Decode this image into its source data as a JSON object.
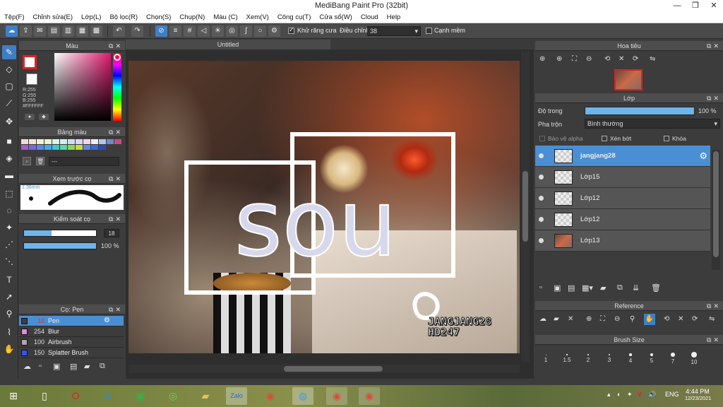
{
  "app": {
    "title": "MediBang Paint Pro (32bit)"
  },
  "menu": [
    "Tệp(F)",
    "Chỉnh sửa(E)",
    "Lớp(L)",
    "Bộ lọc(R)",
    "Chọn(S)",
    "Chụp(N)",
    "Màu (C)",
    "Xem(V)",
    "Công cụ(T)",
    "Cửa sổ(W)",
    "Cloud",
    "Help"
  ],
  "toolbar": {
    "antialias_label": "Khử răng cưa",
    "adjust_label": "Điều chỉnh",
    "adjust_value": "38",
    "smooth_label": "Cạnh mềm"
  },
  "color_panel": {
    "title": "Màu",
    "r": "R:255",
    "g": "G:255",
    "b": "B:255",
    "hex": "#FFFFFF"
  },
  "palette_panel": {
    "title": "Bảng màu",
    "palette_name": "---"
  },
  "brush_preview": {
    "title": "Xem trước cọ",
    "size": "1.36mm"
  },
  "brush_control": {
    "title": "Kiểm soát cọ",
    "size_value": "18",
    "opacity_value": "100 %",
    "size_fill": 0.38,
    "opacity_fill": 1.0
  },
  "brush_list": {
    "title": "Cọ: Pen",
    "items": [
      {
        "size": "18",
        "name": "Pen",
        "color": "#3d3d3d",
        "selected": true
      },
      {
        "size": "254",
        "name": "Blur",
        "color": "#d890d8",
        "selected": false
      },
      {
        "size": "100",
        "name": "Airbrush",
        "color": "#aaaaaa",
        "selected": false
      },
      {
        "size": "150",
        "name": "Splatter Brush",
        "color": "#3355ee",
        "selected": false
      }
    ]
  },
  "canvas": {
    "tab": "Untitled",
    "art_text": "sou",
    "signature_line1": "JANGJANG28",
    "signature_line2": "HD247"
  },
  "navigator": {
    "title": "Hoa tiêu"
  },
  "layer_panel": {
    "title": "Lớp",
    "opacity_label": "Độ trong",
    "opacity_value": "100 %",
    "opacity_fill": 1.0,
    "blend_label": "Pha trộn",
    "blend_value": "Bình thường",
    "protect_alpha": "Bảo vệ alpha",
    "clipping": "Xén bớt",
    "lock": "Khóa",
    "layers": [
      {
        "name": "jangjang28",
        "selected": true
      },
      {
        "name": "Lớp15",
        "selected": false
      },
      {
        "name": "Lớp12",
        "selected": false
      },
      {
        "name": "Lớp12",
        "selected": false
      },
      {
        "name": "Lớp13",
        "selected": false
      }
    ]
  },
  "reference": {
    "title": "Reference"
  },
  "brush_size": {
    "title": "Brush Size",
    "sizes": [
      "1",
      "1.5",
      "2",
      "3",
      "4",
      "5",
      "7",
      "10"
    ]
  },
  "taskbar": {
    "time": "4:44 PM",
    "date": "12/23/2021",
    "lang": "ENG"
  }
}
